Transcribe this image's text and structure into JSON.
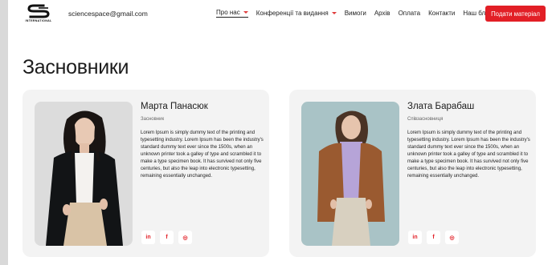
{
  "header": {
    "logo_text": "INTERNATIONAL",
    "email": "sciencespace@gmail.com",
    "nav": [
      {
        "label": "Про нас",
        "dropdown": true,
        "active": true
      },
      {
        "label": "Конференції та видання",
        "dropdown": true,
        "active": false
      },
      {
        "label": "Вимоги",
        "dropdown": false,
        "active": false
      },
      {
        "label": "Архів",
        "dropdown": false,
        "active": false
      },
      {
        "label": "Оплата",
        "dropdown": false,
        "active": false
      },
      {
        "label": "Контакти",
        "dropdown": false,
        "active": false
      },
      {
        "label": "Наш блог",
        "dropdown": false,
        "active": false
      }
    ],
    "submit_label": "Подати матеріал"
  },
  "main": {
    "title": "Засновники",
    "founders": [
      {
        "name": "Марта Панасюк",
        "role": "Засновник",
        "bio": "Lorem Ipsum is simply dummy text of the printing and typesetting industry. Lorem Ipsum has been the industry's standard dummy text ever since the 1500s, when an unknown printer took a galley of type and scrambled it to make a type specimen book. It has survived not only five centuries, but also the leap into electronic typesetting, remaining essentially unchanged.",
        "photo": "founder-photo-woman-dark-blazer"
      },
      {
        "name": "Злата Барабаш",
        "role": "Співзасновниця",
        "bio": "Lorem Ipsum is simply dummy text of the printing and typesetting industry. Lorem Ipsum has been the industry's standard dummy text ever since the 1500s, when an unknown printer took a galley of type and scrambled it to make a type specimen book. It has survived not only five centuries, but also the leap into electronic typesetting, remaining essentially unchanged.",
        "photo": "founder-photo-woman-brown-coat"
      }
    ],
    "socials": [
      {
        "icon": "linkedin-icon",
        "glyph": "in"
      },
      {
        "icon": "facebook-icon",
        "glyph": "f"
      },
      {
        "icon": "instagram-icon",
        "glyph": "◎"
      }
    ]
  },
  "colors": {
    "accent": "#e21f26",
    "card_bg": "#f3f3f3",
    "page_bg": "#ffffff"
  }
}
